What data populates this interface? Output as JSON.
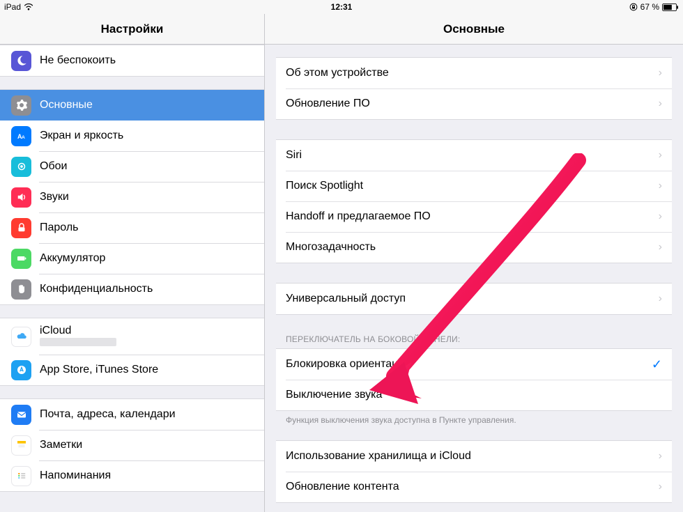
{
  "status": {
    "device": "iPad",
    "time": "12:31",
    "battery": "67 %"
  },
  "sidebar": {
    "title": "Настройки",
    "items": {
      "dnd": "Не беспокоить",
      "general": "Основные",
      "display": "Экран и яркость",
      "wallpaper": "Обои",
      "sounds": "Звуки",
      "passcode": "Пароль",
      "battery": "Аккумулятор",
      "privacy": "Конфиденциальность",
      "icloud": "iCloud",
      "app_store": "App Store, iTunes Store",
      "mail": "Почта, адреса, календари",
      "notes": "Заметки",
      "reminders": "Напоминания"
    }
  },
  "detail": {
    "title": "Основные",
    "groups": {
      "about_device": "Об этом устройстве",
      "software_update": "Обновление ПО",
      "siri": "Siri",
      "spotlight": "Поиск Spotlight",
      "handoff": "Handoff и предлагаемое ПО",
      "multitasking": "Многозадачность",
      "accessibility": "Универсальный доступ",
      "side_switch_header": "ПЕРЕКЛЮЧАТЕЛЬ НА БОКОВОЙ ПАНЕЛИ:",
      "lock_rotation": "Блокировка ориентации",
      "mute": "Выключение звука",
      "side_switch_footer": "Функция выключения звука доступна в Пункте управления.",
      "storage": "Использование хранилища и iCloud",
      "background_refresh": "Обновление контента"
    }
  },
  "icon_colors": {
    "dnd": "#5856d6",
    "general": "#8e8e93",
    "display": "#007aff",
    "wallpaper": "#13c1de",
    "sounds": "#ff2d55",
    "passcode": "#ff3b30",
    "battery": "#4cd964",
    "privacy": "#8e8e93",
    "mail": "#1f7cf4",
    "notes": "#fdc300",
    "reminders": "#ffffff",
    "app_store": "#1da1f2"
  }
}
